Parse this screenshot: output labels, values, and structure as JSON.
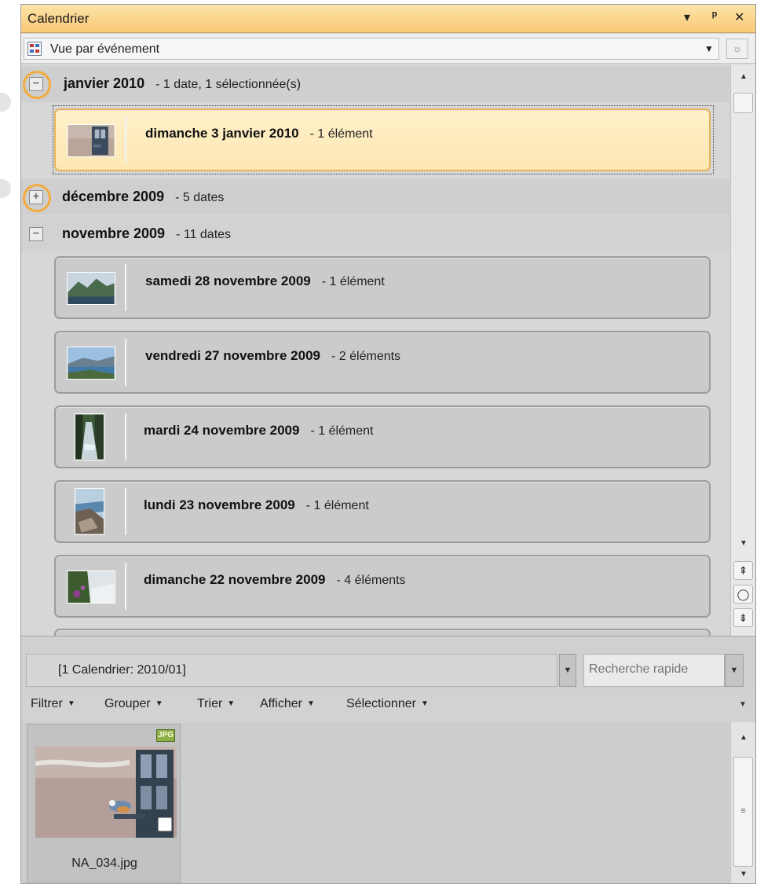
{
  "window": {
    "title": "Calendrier",
    "buttons": {
      "menu": "▾",
      "pin": "ᵖ",
      "close": "✕"
    }
  },
  "view": {
    "selected": "Vue par événement",
    "icon": "calendar-grid-icon"
  },
  "months": [
    {
      "name": "janvier 2010",
      "info": "- 1 date, 1 sélectionnée(s)",
      "expanded": true,
      "toggle": "−"
    },
    {
      "name": "décembre 2009",
      "info": "- 5 dates",
      "expanded": false,
      "toggle": "+"
    },
    {
      "name": "novembre 2009",
      "info": "- 11 dates",
      "expanded": true,
      "toggle": "−"
    }
  ],
  "dates": [
    {
      "label": "dimanche 3 janvier 2010",
      "count": "- 1 élément",
      "selected": true
    },
    {
      "label": "samedi 28 novembre 2009",
      "count": "- 1 élément"
    },
    {
      "label": "vendredi 27 novembre 2009",
      "count": "- 2 éléments"
    },
    {
      "label": "mardi 24 novembre 2009",
      "count": "- 1 élément"
    },
    {
      "label": "lundi 23 novembre 2009",
      "count": "- 1 élément"
    },
    {
      "label": "dimanche 22 novembre 2009",
      "count": "- 4 éléments"
    }
  ],
  "status": {
    "text": "[1 Calendrier: 2010/01]"
  },
  "search": {
    "placeholder": "Recherche rapide"
  },
  "toolbar": {
    "items": [
      "Filtrer",
      "Grouper",
      "Trier",
      "Afficher",
      "Sélectionner"
    ]
  },
  "file": {
    "name": "NA_034.jpg",
    "badge": "JPG"
  },
  "colors": {
    "titlebar": "#f9c978",
    "selected_card": "#fde7b4",
    "highlight_ring": "#f2ab3c",
    "panel_bg": "#d4d4d4"
  }
}
